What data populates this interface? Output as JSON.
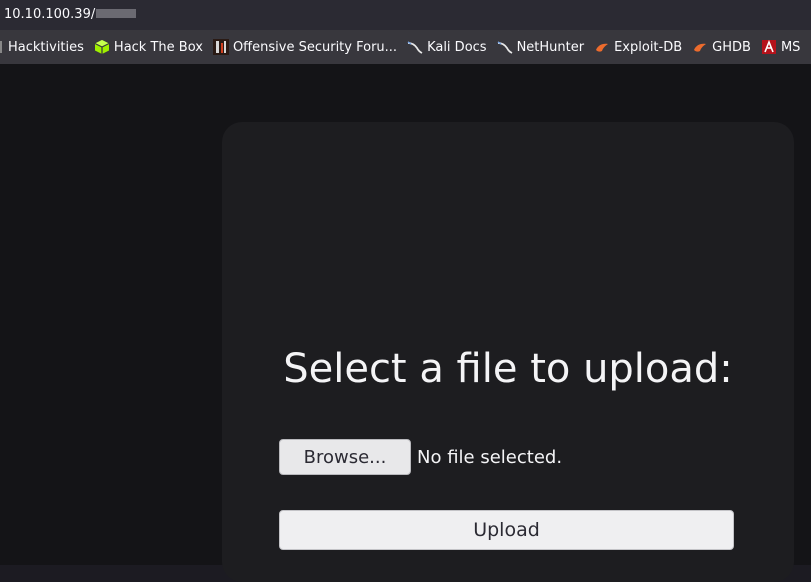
{
  "browser": {
    "url": "10.10.100.39/",
    "bookmarks": [
      {
        "label": "Hacktivities",
        "icon": "thm-icon"
      },
      {
        "label": "Hack The Box",
        "icon": "htb-cube-icon"
      },
      {
        "label": "Offensive Security Foru...",
        "icon": "offsec-icon"
      },
      {
        "label": "Kali Docs",
        "icon": "kali-dragon-icon"
      },
      {
        "label": "NetHunter",
        "icon": "kali-dragon-icon"
      },
      {
        "label": "Exploit-DB",
        "icon": "exploitdb-icon"
      },
      {
        "label": "GHDB",
        "icon": "exploitdb-icon"
      },
      {
        "label": "MS",
        "icon": "msfu-icon"
      }
    ]
  },
  "upload_form": {
    "heading": "Select a file to upload:",
    "browse_label": "Browse...",
    "file_status": "No file selected.",
    "upload_label": "Upload"
  },
  "colors": {
    "page_background": "#141417",
    "card_background": "#1d1d20",
    "text": "#f4f4f6",
    "button_background": "#e8e8ea"
  }
}
